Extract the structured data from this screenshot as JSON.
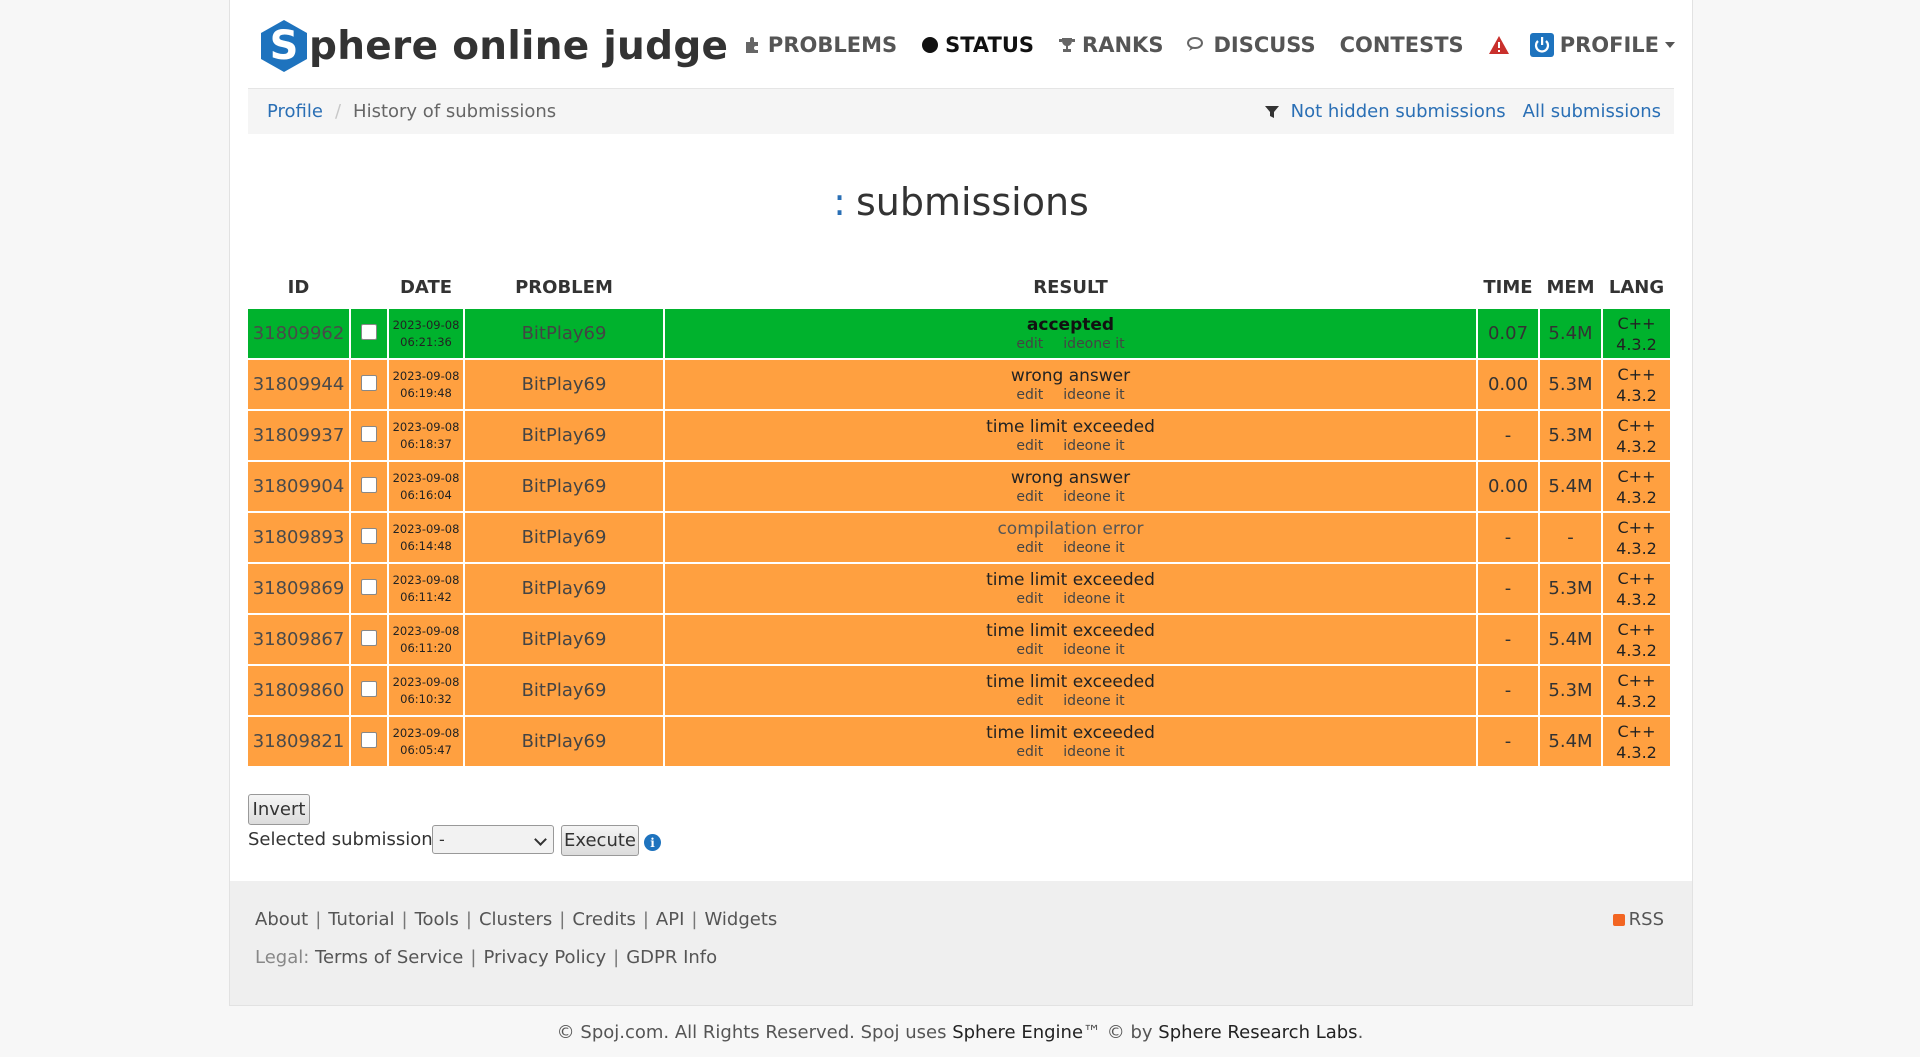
{
  "header": {
    "logo_letter": "S",
    "logo_text": "phere online judge",
    "nav": [
      {
        "label": "PROBLEMS",
        "icon": "puzzle-icon"
      },
      {
        "label": "STATUS",
        "icon": "circle-icon",
        "active": true
      },
      {
        "label": "RANKS",
        "icon": "trophy-icon"
      },
      {
        "label": "DISCUSS",
        "icon": "chat-bubbles-icon"
      },
      {
        "label": "CONTESTS",
        "icon": ""
      },
      {
        "label": "PROFILE",
        "icon": "power-icon"
      }
    ],
    "warning_icon": "warning-triangle-icon"
  },
  "breadcrumb": {
    "link": "Profile",
    "current": "History of submissions",
    "filter_icon": "filter-icon",
    "right_links": [
      "Not hidden submissions",
      "All submissions"
    ]
  },
  "title": {
    "prefix": ":",
    "text": "submissions"
  },
  "table": {
    "headers": [
      "ID",
      "DATE",
      "PROBLEM",
      "RESULT",
      "TIME",
      "MEM",
      "LANG"
    ],
    "edit_label": "edit",
    "ideone_label": "ideone it",
    "rows": [
      {
        "id": "31809962",
        "date": "2023-09-08",
        "time_of_day": "06:21:36",
        "problem": "BitPlay69",
        "result": "accepted",
        "time": "0.07",
        "mem": "5.4M",
        "lang": "C++",
        "lang_ver": "4.3.2",
        "status": "accepted"
      },
      {
        "id": "31809944",
        "date": "2023-09-08",
        "time_of_day": "06:19:48",
        "problem": "BitPlay69",
        "result": "wrong answer",
        "time": "0.00",
        "mem": "5.3M",
        "lang": "C++",
        "lang_ver": "4.3.2",
        "status": "wrong"
      },
      {
        "id": "31809937",
        "date": "2023-09-08",
        "time_of_day": "06:18:37",
        "problem": "BitPlay69",
        "result": "time limit exceeded",
        "time": "-",
        "mem": "5.3M",
        "lang": "C++",
        "lang_ver": "4.3.2",
        "status": "wrong"
      },
      {
        "id": "31809904",
        "date": "2023-09-08",
        "time_of_day": "06:16:04",
        "problem": "BitPlay69",
        "result": "wrong answer",
        "time": "0.00",
        "mem": "5.4M",
        "lang": "C++",
        "lang_ver": "4.3.2",
        "status": "wrong"
      },
      {
        "id": "31809893",
        "date": "2023-09-08",
        "time_of_day": "06:14:48",
        "problem": "BitPlay69",
        "result": "compilation error",
        "time": "-",
        "mem": "-",
        "lang": "C++",
        "lang_ver": "4.3.2",
        "status": "ce"
      },
      {
        "id": "31809869",
        "date": "2023-09-08",
        "time_of_day": "06:11:42",
        "problem": "BitPlay69",
        "result": "time limit exceeded",
        "time": "-",
        "mem": "5.3M",
        "lang": "C++",
        "lang_ver": "4.3.2",
        "status": "wrong"
      },
      {
        "id": "31809867",
        "date": "2023-09-08",
        "time_of_day": "06:11:20",
        "problem": "BitPlay69",
        "result": "time limit exceeded",
        "time": "-",
        "mem": "5.4M",
        "lang": "C++",
        "lang_ver": "4.3.2",
        "status": "wrong"
      },
      {
        "id": "31809860",
        "date": "2023-09-08",
        "time_of_day": "06:10:32",
        "problem": "BitPlay69",
        "result": "time limit exceeded",
        "time": "-",
        "mem": "5.3M",
        "lang": "C++",
        "lang_ver": "4.3.2",
        "status": "wrong"
      },
      {
        "id": "31809821",
        "date": "2023-09-08",
        "time_of_day": "06:05:47",
        "problem": "BitPlay69",
        "result": "time limit exceeded",
        "time": "-",
        "mem": "5.4M",
        "lang": "C++",
        "lang_ver": "4.3.2",
        "status": "wrong"
      }
    ]
  },
  "controls": {
    "invert_label": "Invert",
    "selected_label": "Selected submissions:",
    "select_value": "-",
    "execute_label": "Execute",
    "info_icon": "info-icon"
  },
  "footer": {
    "links": [
      "About",
      "Tutorial",
      "Tools",
      "Clusters",
      "Credits",
      "API",
      "Widgets"
    ],
    "legal_label": "Legal:",
    "legal_links": [
      "Terms of Service",
      "Privacy Policy",
      "GDPR Info"
    ],
    "rss_label": "RSS",
    "copyright_prefix": "© Spoj.com. All Rights Reserved. Spoj uses",
    "engine_link": "Sphere Engine",
    "copyright_mid": "™ © by",
    "labs_link": "Sphere Research Labs",
    "copyright_end": "."
  },
  "colors": {
    "accent": "#2a6fb5",
    "accepted_row": "#00b22d",
    "other_row": "#ffa040",
    "logo": "#1e73be"
  }
}
